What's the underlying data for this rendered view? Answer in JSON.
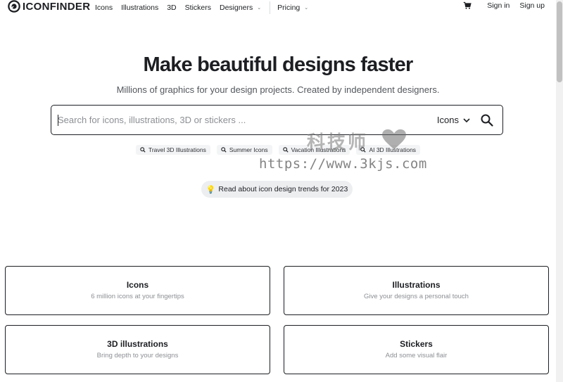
{
  "header": {
    "logo_text": "ICONFINDER",
    "nav": [
      {
        "label": "Icons"
      },
      {
        "label": "Illustrations"
      },
      {
        "label": "3D"
      },
      {
        "label": "Stickers"
      },
      {
        "label": "Designers"
      },
      {
        "label": "Pricing"
      }
    ],
    "sign_in": "Sign in",
    "sign_up": "Sign up"
  },
  "hero": {
    "title_pre": "Make ",
    "title_highlight": "beautiful designs",
    "title_post": " faster",
    "subtitle": "Millions of graphics for your design projects. Created by independent designers."
  },
  "search": {
    "placeholder": "Search for icons, illustrations, 3D or stickers ...",
    "value": "",
    "type_selected": "Icons"
  },
  "suggestions": [
    {
      "label": "Travel 3D Illustrations"
    },
    {
      "label": "Summer Icons"
    },
    {
      "label": "Vacation Illustrations"
    },
    {
      "label": "AI 3D Illustrations"
    }
  ],
  "watermark": {
    "title": "科技师",
    "url": "https://www.3kjs.com"
  },
  "trend_link": {
    "label": "Read about icon design trends for 2023"
  },
  "categories": [
    {
      "title": "Icons",
      "description": "6 million icons at your fingertips"
    },
    {
      "title": "Illustrations",
      "description": "Give your designs a personal touch"
    },
    {
      "title": "3D illustrations",
      "description": "Bring depth to your designs"
    },
    {
      "title": "Stickers",
      "description": "Add some visual flair"
    }
  ],
  "colors": {
    "text": "#1c1e22",
    "muted": "#8c8f94",
    "highlight": "#fbd692",
    "chip_bg": "#f3f4f5"
  }
}
